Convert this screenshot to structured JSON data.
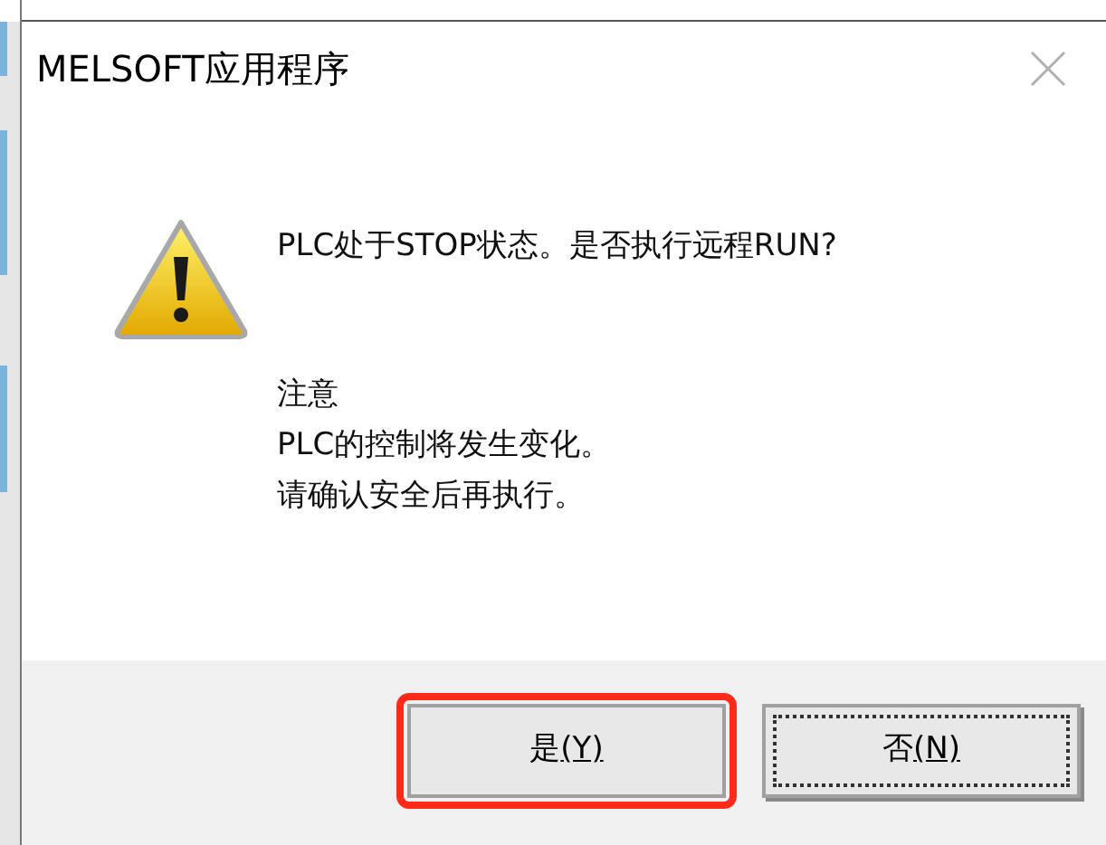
{
  "window": {
    "title": "MELSOFT应用程序"
  },
  "message": {
    "question": "PLC处于STOP状态。是否执行远程RUN?",
    "note_heading": "注意",
    "note_lines": [
      "PLC的控制将发生变化。",
      "请确认安全后再执行。"
    ]
  },
  "buttons": [
    {
      "label": "是",
      "hotkey": "(Y)",
      "focused": false,
      "highlighted": true
    },
    {
      "label": "否",
      "hotkey": "(N)",
      "focused": true,
      "highlighted": false
    }
  ]
}
